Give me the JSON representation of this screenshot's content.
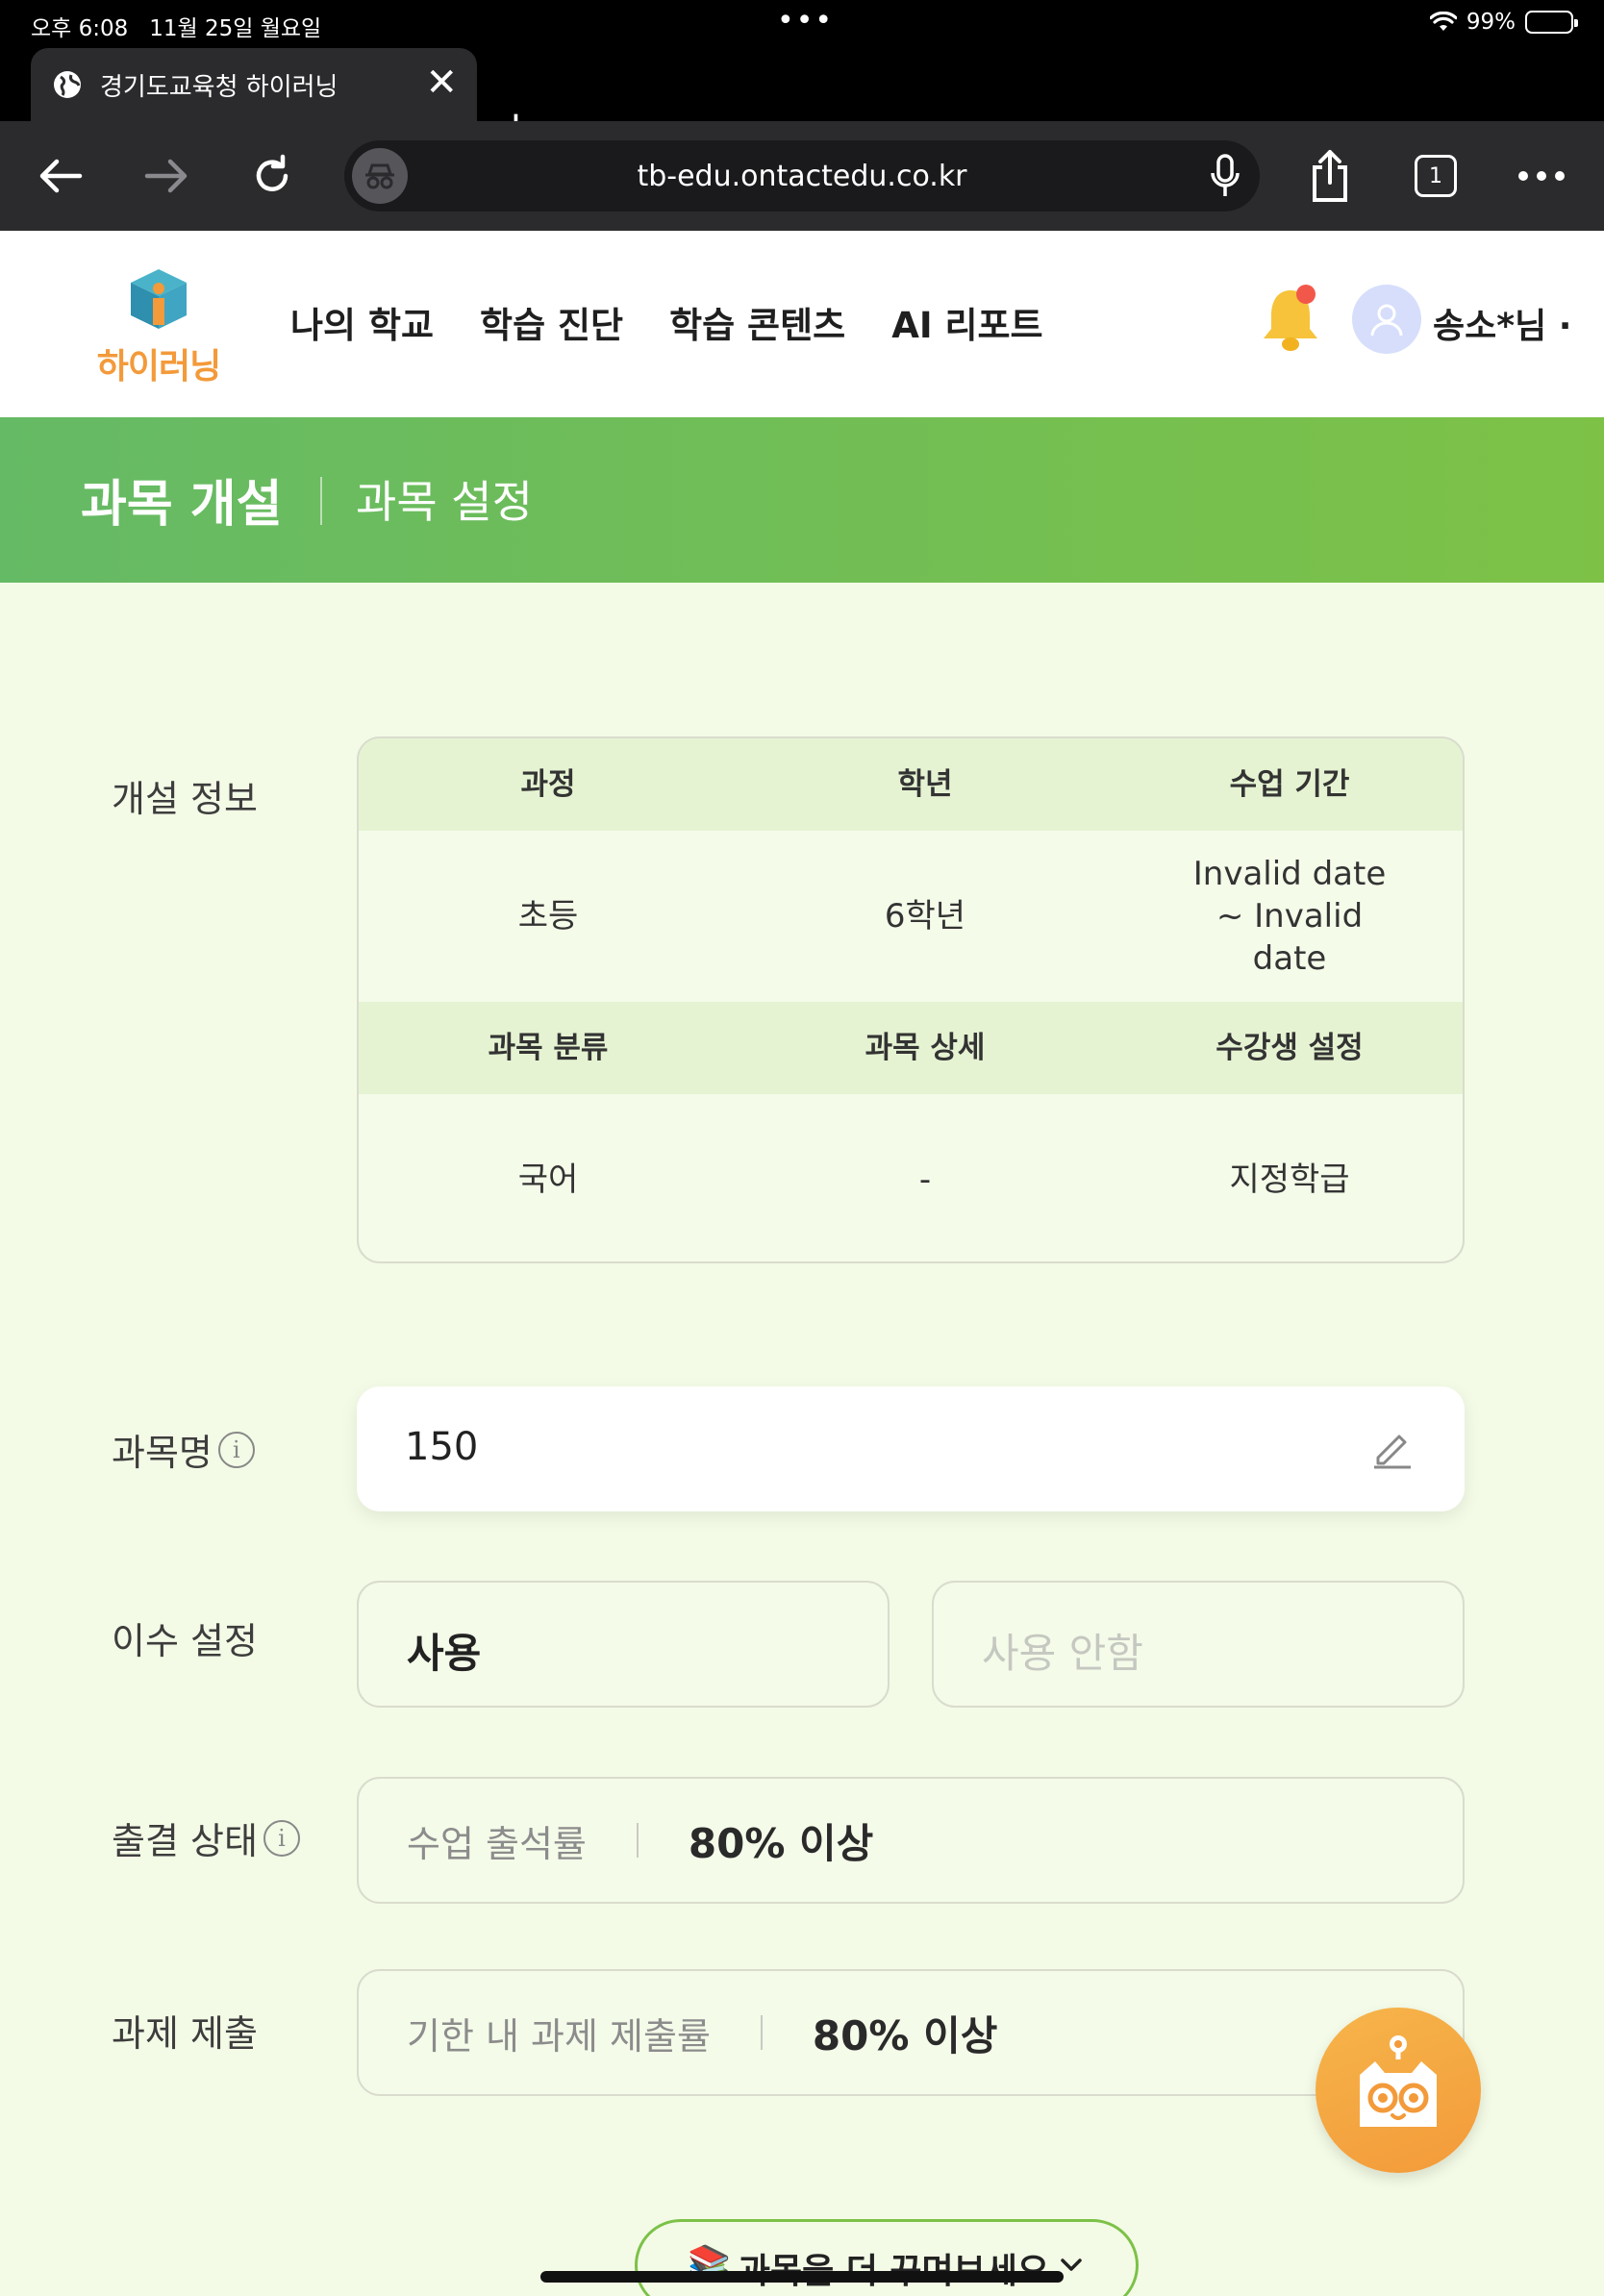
{
  "status_bar": {
    "time": "오후 6:08",
    "date": "11월 25일 월요일",
    "battery": "99%"
  },
  "browser": {
    "tab_title": "경기도교육청 하이러닝",
    "url": "tb-edu.ontactedu.co.kr",
    "tab_count": "1"
  },
  "site": {
    "logo_text": "하이러닝",
    "nav": [
      "나의 학교",
      "학습 진단",
      "학습 콘텐츠",
      "AI 리포트"
    ],
    "username": "송소*님 ·"
  },
  "banner": {
    "title": "과목 개설",
    "subtitle": "과목 설정"
  },
  "open_info": {
    "label": "개설 정보",
    "headers1": [
      "과정",
      "학년",
      "수업 기간"
    ],
    "values1": [
      "초등",
      "6학년",
      "Invalid date ~ Invalid date"
    ],
    "headers2": [
      "과목 분류",
      "과목 상세",
      "수강생 설정"
    ],
    "values2": [
      "국어",
      "-",
      "지정학급"
    ]
  },
  "course_name": {
    "label": "과목명",
    "value": "150"
  },
  "completion": {
    "label": "이수 설정",
    "on_label": "사용",
    "off_label": "사용 안함"
  },
  "attendance": {
    "label": "출결 상태",
    "key": "수업 출석률",
    "value": "80% 이상"
  },
  "assignment": {
    "label": "과제 제출",
    "key": "기한 내 과제 제출률",
    "value": "80% 이상"
  },
  "more_button": {
    "icon": "📚",
    "label": "과목을 더 꾸며보세요"
  },
  "colors": {
    "brand_orange": "#f39a3a",
    "banner_green_start": "#65ba65",
    "banner_green_end": "#7dc247",
    "page_bg": "#f3fbe6"
  }
}
